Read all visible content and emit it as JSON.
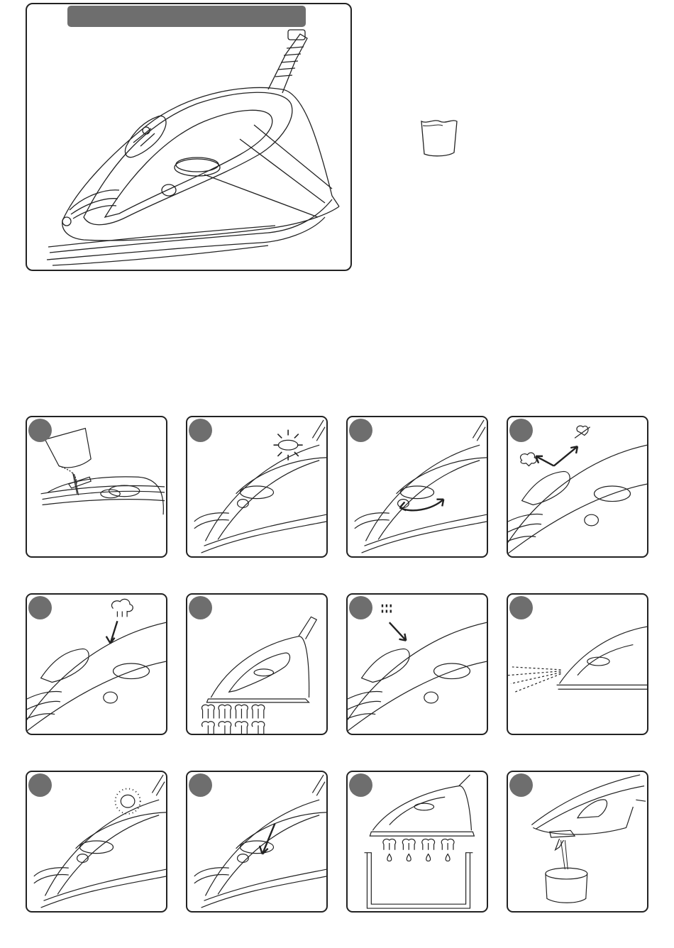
{
  "page": {
    "main_title": ""
  },
  "steps": [
    {
      "badge": "",
      "icon": "fill-water-icon"
    },
    {
      "badge": "",
      "icon": "indicator-light-icon"
    },
    {
      "badge": "",
      "icon": "temperature-dial-icon"
    },
    {
      "badge": "",
      "icon": "steam-selector-icon"
    },
    {
      "badge": "",
      "icon": "steam-burst-icon"
    },
    {
      "badge": "",
      "icon": "vertical-steam-icon"
    },
    {
      "badge": "",
      "icon": "spray-button-icon"
    },
    {
      "badge": "",
      "icon": "spray-mist-icon"
    },
    {
      "badge": "",
      "icon": "self-clean-icon"
    },
    {
      "badge": "",
      "icon": "anti-calc-icon"
    },
    {
      "badge": "",
      "icon": "drain-tank-icon"
    },
    {
      "badge": "",
      "icon": "empty-water-icon"
    }
  ],
  "colors": {
    "badge": "#6e6e6e",
    "outline": "#222222",
    "title_bar": "#6e6e6e"
  }
}
